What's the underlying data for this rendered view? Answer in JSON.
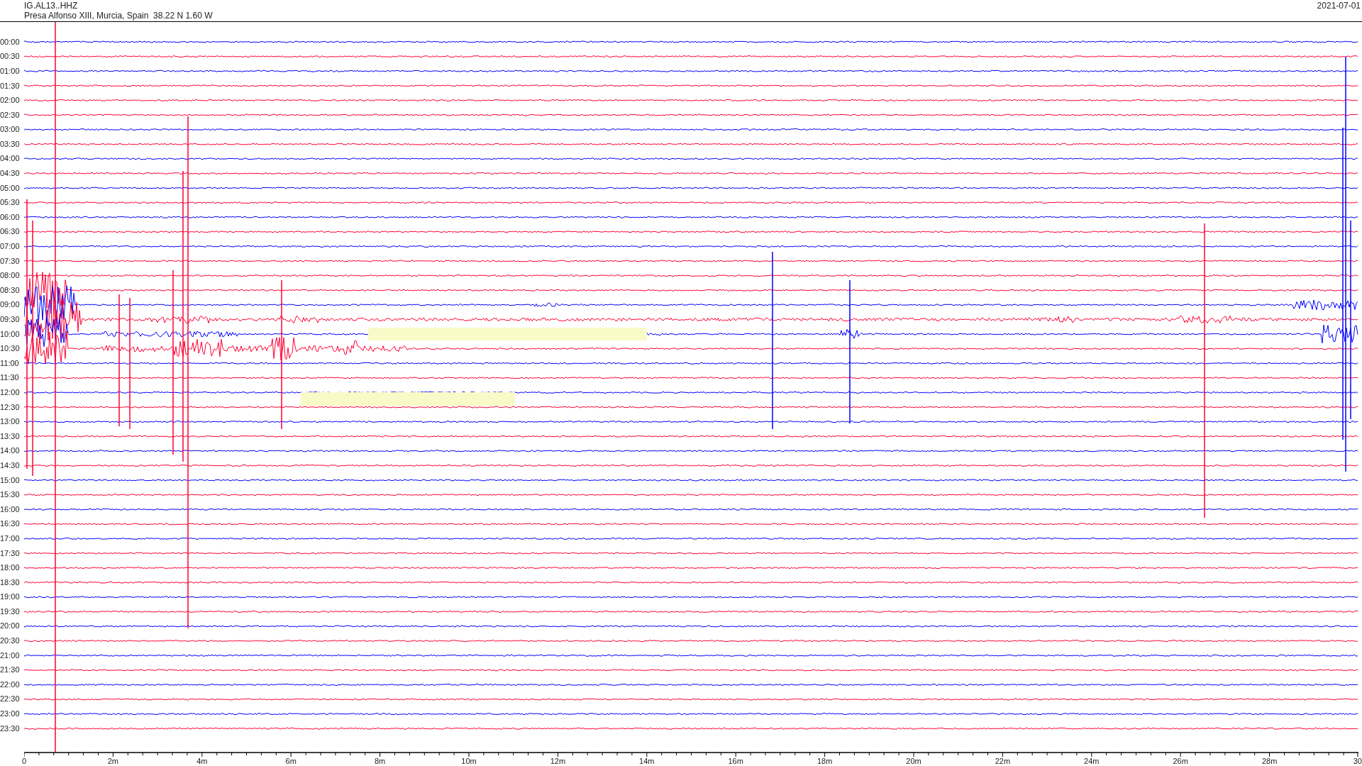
{
  "header": {
    "station": "IG.AL13..HHZ",
    "location": "Presa Alfonso XIII, Murcia, Spain  38.22 N 1.60 W",
    "date": "2021-07-01"
  },
  "rows": [
    {
      "label": "00:00",
      "color": "#0000ff"
    },
    {
      "label": "00:30",
      "color": "#ff0033"
    },
    {
      "label": "01:00",
      "color": "#0000ff"
    },
    {
      "label": "01:30",
      "color": "#ff0033"
    },
    {
      "label": "02:00",
      "color": "#ff0033"
    },
    {
      "label": "02:30",
      "color": "#ff0033"
    },
    {
      "label": "03:00",
      "color": "#0000ff"
    },
    {
      "label": "03:30",
      "color": "#ff0033"
    },
    {
      "label": "04:00",
      "color": "#0000ff"
    },
    {
      "label": "04:30",
      "color": "#ff0033"
    },
    {
      "label": "05:00",
      "color": "#0000ff"
    },
    {
      "label": "05:30",
      "color": "#ff0033"
    },
    {
      "label": "06:00",
      "color": "#0000ff"
    },
    {
      "label": "06:30",
      "color": "#ff0033"
    },
    {
      "label": "07:00",
      "color": "#0000ff"
    },
    {
      "label": "07:30",
      "color": "#ff0033"
    },
    {
      "label": "08:00",
      "color": "#ff0033"
    },
    {
      "label": "08:30",
      "color": "#ff0033"
    },
    {
      "label": "09:00",
      "color": "#0000ff"
    },
    {
      "label": "09:30",
      "color": "#ff0033"
    },
    {
      "label": "10:00",
      "color": "#0000ff"
    },
    {
      "label": "10:30",
      "color": "#ff0033"
    },
    {
      "label": "11:00",
      "color": "#0000ff"
    },
    {
      "label": "11:30",
      "color": "#ff0033"
    },
    {
      "label": "12:00",
      "color": "#0000ff"
    },
    {
      "label": "12:30",
      "color": "#ff0033"
    },
    {
      "label": "13:00",
      "color": "#0000ff"
    },
    {
      "label": "13:30",
      "color": "#ff0033"
    },
    {
      "label": "14:00",
      "color": "#0000ff"
    },
    {
      "label": "14:30",
      "color": "#ff0033"
    },
    {
      "label": "15:00",
      "color": "#0000ff"
    },
    {
      "label": "15:30",
      "color": "#ff0033"
    },
    {
      "label": "16:00",
      "color": "#0000ff"
    },
    {
      "label": "16:30",
      "color": "#ff0033"
    },
    {
      "label": "17:00",
      "color": "#0000ff"
    },
    {
      "label": "17:30",
      "color": "#ff0033"
    },
    {
      "label": "18:00",
      "color": "#ff0033"
    },
    {
      "label": "18:30",
      "color": "#ff0033"
    },
    {
      "label": "19:00",
      "color": "#0000ff"
    },
    {
      "label": "19:30",
      "color": "#ff0033"
    },
    {
      "label": "20:00",
      "color": "#0000ff"
    },
    {
      "label": "20:30",
      "color": "#ff0033"
    },
    {
      "label": "21:00",
      "color": "#0000ff"
    },
    {
      "label": "21:30",
      "color": "#ff0033"
    },
    {
      "label": "22:00",
      "color": "#0000ff"
    },
    {
      "label": "22:30",
      "color": "#ff0033"
    },
    {
      "label": "23:00",
      "color": "#0000ff"
    },
    {
      "label": "23:30",
      "color": "#ff0033"
    }
  ],
  "x_axis": {
    "ticks": [
      "0",
      "2m",
      "4m",
      "6m",
      "8m",
      "10m",
      "12m",
      "14m",
      "16m",
      "18m",
      "20m",
      "22m",
      "24m",
      "26m",
      "28m",
      "30"
    ]
  }
}
